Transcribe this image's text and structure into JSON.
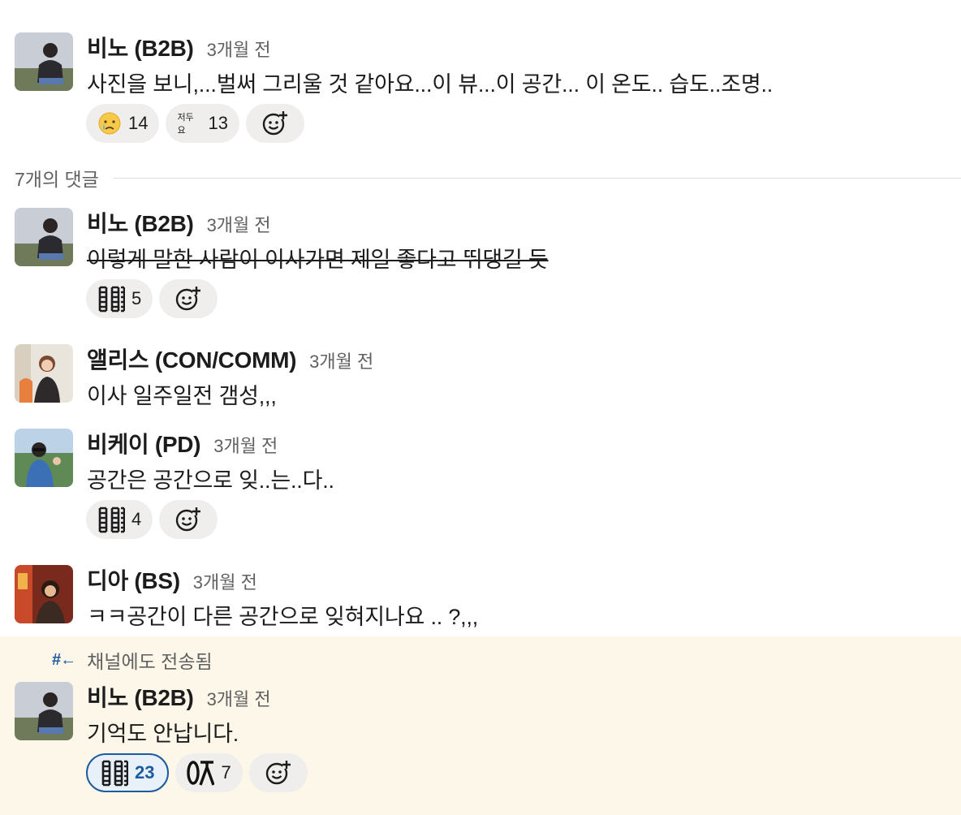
{
  "time_label": "3개월 전",
  "thread_divider": "7개의 댓글",
  "sent_to_channel": "채널에도 전송됨",
  "messages": [
    {
      "author": "비노 (B2B)",
      "time": "3개월 전",
      "text": "사진을 보니,...벌써 그리울 것 같아요...이 뷰...이 공간... 이 온도.. 습도..조명..",
      "reactions": [
        {
          "emoji": "crying-face-icon",
          "count": "14"
        },
        {
          "emoji": "jeodoyo-text-emoji",
          "emoji_text": "저두요",
          "count": "13"
        }
      ]
    },
    {
      "author": "비노 (B2B)",
      "time": "3개월 전",
      "text": "이렇게 말한 사람이 이사가면 제일 좋다고 뛰댕길 듯",
      "reactions": [
        {
          "emoji": "crying-lines-emoji",
          "count": "5"
        }
      ]
    },
    {
      "author": "앨리스 (CON/COMM)",
      "time": "3개월 전",
      "text": "이사 일주일전 갬성,,,"
    },
    {
      "author": "비케이 (PD)",
      "time": "3개월 전",
      "text": "공간은 공간으로 잊..는..다..",
      "reactions": [
        {
          "emoji": "crying-lines-emoji",
          "count": "4"
        }
      ]
    },
    {
      "author": "디아 (BS)",
      "time": "3개월 전",
      "text": "ㅋㅋ공간이 다른 공간으로 잊혀지나요 .. ?,,,"
    },
    {
      "author": "비노 (B2B)",
      "time": "3개월 전",
      "text": "기억도 안납니다.",
      "reactions": [
        {
          "emoji": "crying-lines-emoji",
          "count": "23",
          "selected": true
        },
        {
          "emoji": "ox-emoji",
          "count": "7"
        }
      ]
    }
  ],
  "colors": {
    "highlight_bg": "#fcf7e8",
    "reaction_bg": "#efeeec",
    "selected_accent": "#1d5b9c",
    "muted_text": "#616061"
  }
}
